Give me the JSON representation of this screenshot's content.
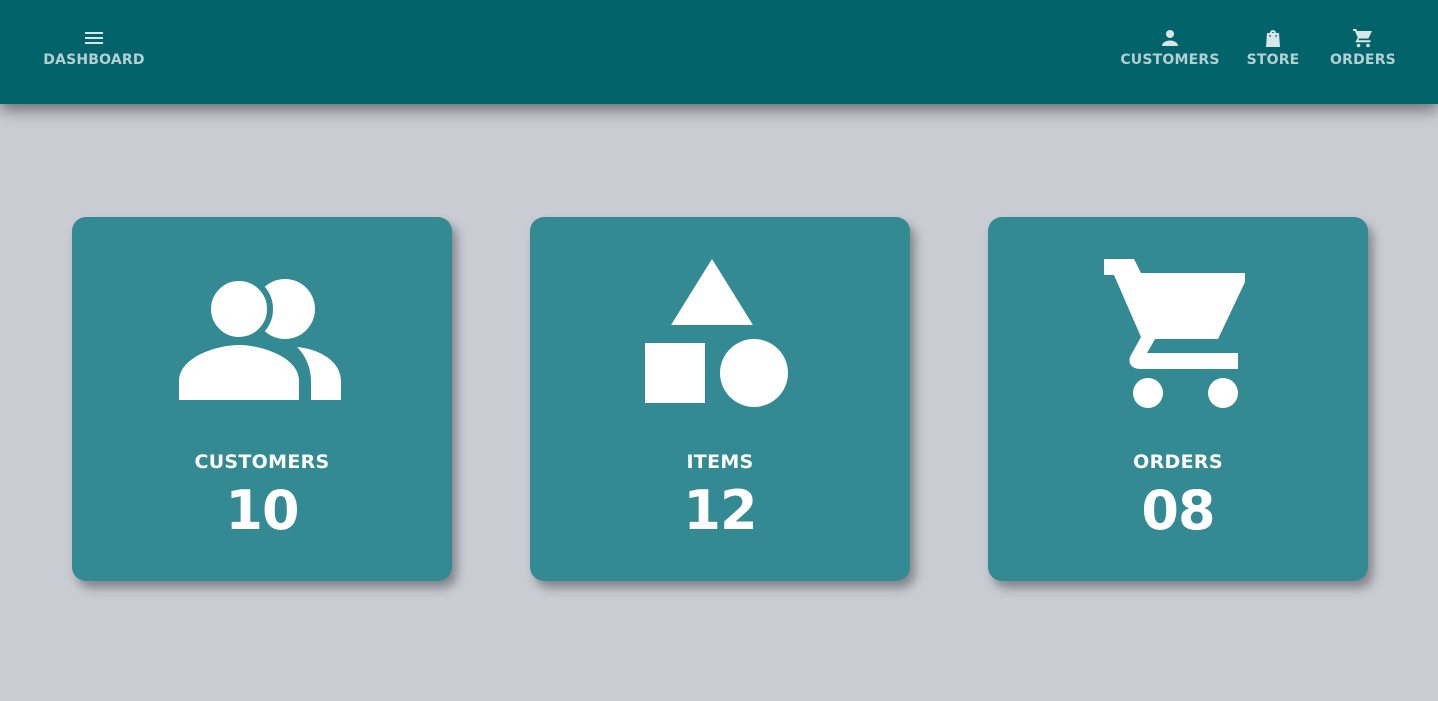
{
  "header": {
    "nav_left": {
      "label": "DASHBOARD",
      "icon": "menu-icon"
    },
    "nav_right": [
      {
        "label": "CUSTOMERS",
        "icon": "person-icon"
      },
      {
        "label": "STORE",
        "icon": "shopping-bag-icon"
      },
      {
        "label": "ORDERS",
        "icon": "shopping-cart-icon"
      }
    ]
  },
  "cards": [
    {
      "label": "CUSTOMERS",
      "value": "10",
      "icon": "people-icon"
    },
    {
      "label": "ITEMS",
      "value": "12",
      "icon": "shapes-icon"
    },
    {
      "label": "ORDERS",
      "value": "08",
      "icon": "shopping-cart-icon"
    }
  ],
  "colors": {
    "header_bg": "#02646a",
    "card_bg": "#348a92",
    "page_bg": "#c9ccd3",
    "nav_text": "#b5d0d2",
    "card_text": "#ffffff"
  }
}
